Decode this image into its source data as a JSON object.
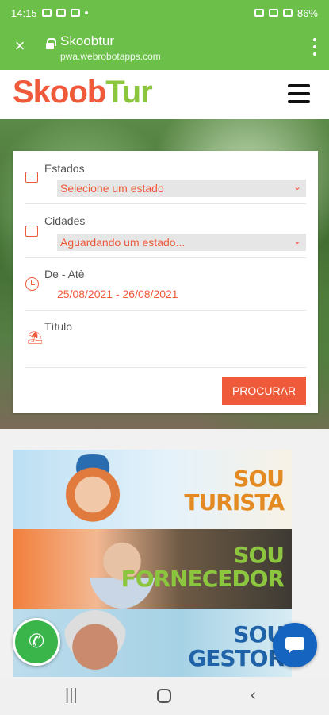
{
  "status_bar": {
    "time": "14:15",
    "battery": "86%"
  },
  "browser": {
    "title": "Skoobtur",
    "url": "pwa.webrobotapps.com"
  },
  "site": {
    "logo_part1": "Skoob",
    "logo_part2": "Tur"
  },
  "search": {
    "estados_label": "Estados",
    "estados_value": "Selecione um estado",
    "cidades_label": "Cidades",
    "cidades_value": "Aguardando um estado...",
    "dates_label": "De - Atè",
    "dates_value": "25/08/2021 - 26/08/2021",
    "titulo_label": "Título",
    "button": "PROCURAR"
  },
  "banners": [
    {
      "line1": "SOU",
      "line2": "TURISTA"
    },
    {
      "line1": "SOU",
      "line2": "FORNECEDOR"
    },
    {
      "line1": "SOU",
      "line2": "GESTOR"
    }
  ],
  "nav_icons": [
    "recent-apps-icon",
    "home-icon",
    "back-icon"
  ]
}
